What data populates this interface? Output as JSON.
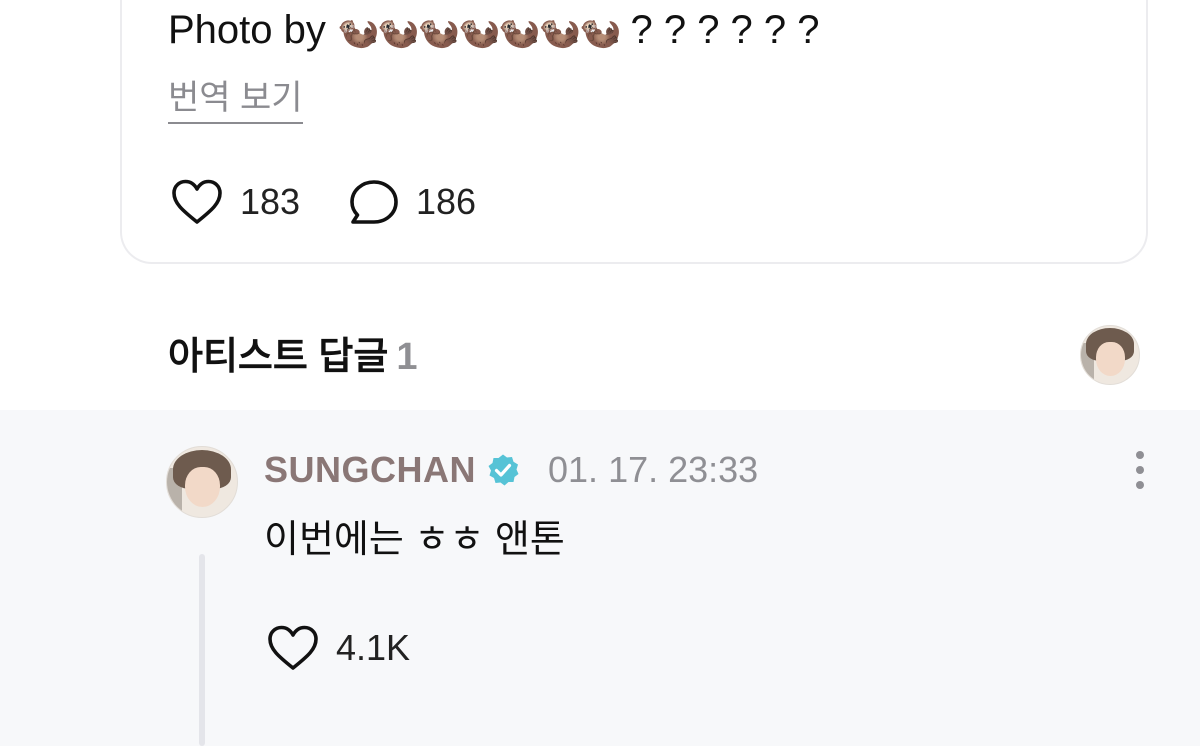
{
  "post": {
    "text_prefix": "Photo by",
    "otters": "🦦🦦🦦🦦🦦🦦🦦",
    "text_suffix": " ? ? ? ? ? ?",
    "translate_label": "번역 보기",
    "like_count": "183",
    "comment_count": "186"
  },
  "artist_replies": {
    "title": "아티스트 답글",
    "count": "1"
  },
  "reply": {
    "author": "SUNGCHAN",
    "timestamp": "01. 17. 23:33",
    "text": "이번에는 ㅎㅎ 앤톤",
    "like_count": "4.1K"
  },
  "colors": {
    "author_name": "#8a7776",
    "verified_badge": "#56c3d6",
    "reply_background": "#f7f8fa",
    "muted_text": "#8f8f94"
  },
  "icons": {
    "like": "heart-outline-icon",
    "comment": "speech-bubble-outline-icon",
    "verified": "verified-badge-icon",
    "more": "vertical-ellipsis-icon"
  }
}
